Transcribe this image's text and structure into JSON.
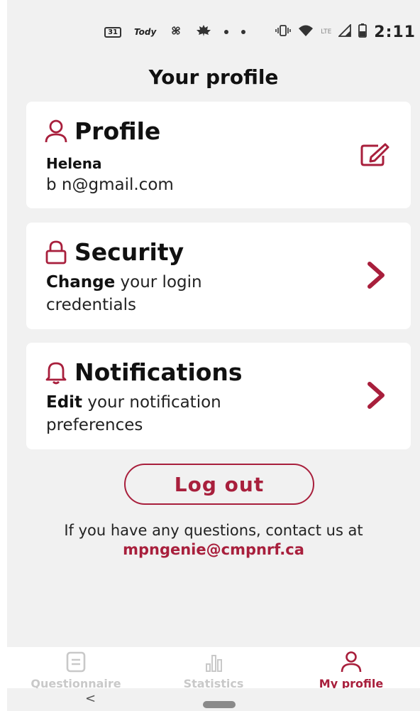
{
  "status_bar": {
    "calendar_day": "31",
    "app_label": "Tody",
    "network": "LTE",
    "time": "2:11"
  },
  "page": {
    "title": "Your profile"
  },
  "profile_card": {
    "title": "Profile",
    "name": "Helena",
    "email": "b       n@gmail.com",
    "icon": "person-icon",
    "edit_icon": "edit-icon"
  },
  "security_card": {
    "title": "Security",
    "desc_bold": "Change",
    "desc_rest": " your login credentials",
    "icon": "lock-icon"
  },
  "notifications_card": {
    "title": "Notifications",
    "desc_bold": "Edit",
    "desc_rest": " your notification preferences",
    "icon": "bell-icon"
  },
  "logout": {
    "label": "Log out"
  },
  "contact": {
    "text": "If you have any questions, contact us at",
    "email": "mpngenie@cmpnrf.ca"
  },
  "bottom_nav": {
    "items": [
      {
        "label": "Questionnaire",
        "icon": "questionnaire-icon",
        "active": false
      },
      {
        "label": "Statistics",
        "icon": "bar-chart-icon",
        "active": false
      },
      {
        "label": "My profile",
        "icon": "person-icon",
        "active": true
      }
    ]
  },
  "colors": {
    "accent": "#a81f3c",
    "background": "#f1f1f1",
    "card": "#ffffff",
    "inactive": "#c9c9c9"
  }
}
